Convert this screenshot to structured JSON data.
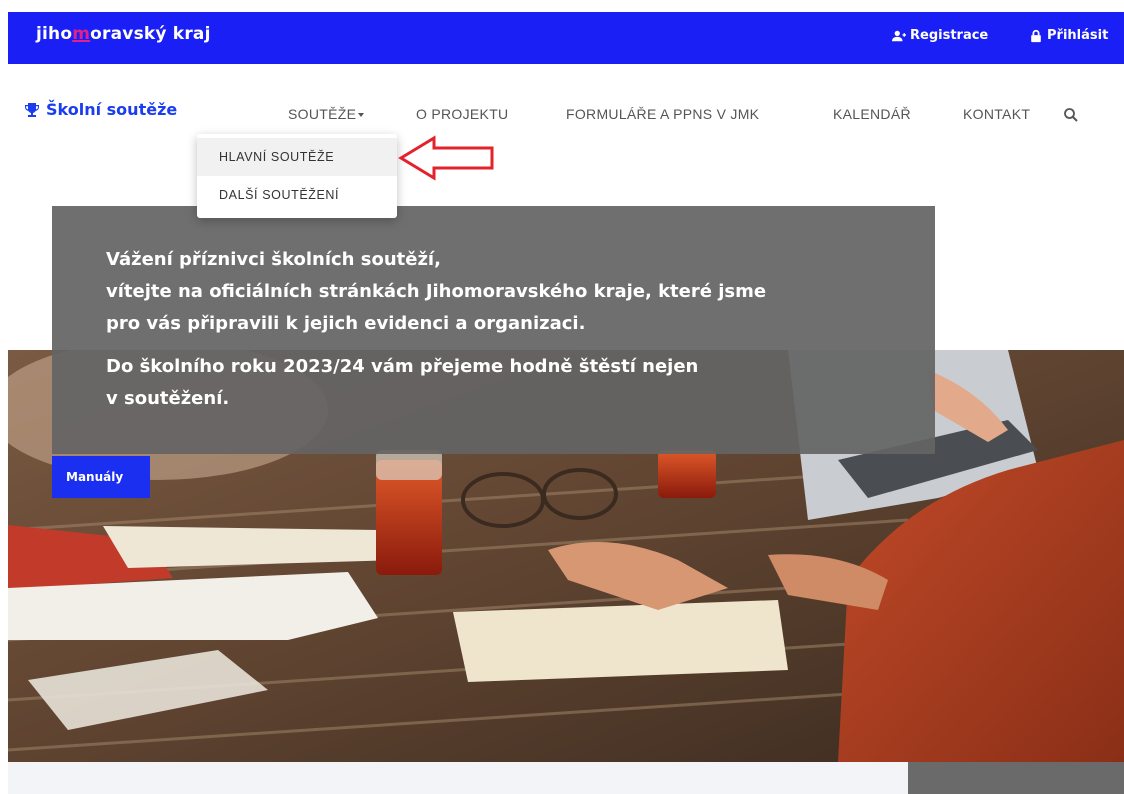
{
  "topbar": {
    "logo_before": "jiho",
    "logo_accent": "m",
    "logo_after": "oravský kraj",
    "register_label": "Registrace",
    "login_label": "Přihlásit",
    "bg_color": "#1a1ff5",
    "accent_color": "#e0218a"
  },
  "nav": {
    "site_title": "Školní soutěže",
    "site_icon": "trophy-icon",
    "items": [
      {
        "label": "SOUTĚŽE",
        "has_caret": true
      },
      {
        "label": "O PROJEKTU"
      },
      {
        "label": "FORMULÁŘE A PPNS V JMK"
      },
      {
        "label": "KALENDÁŘ"
      },
      {
        "label": "KONTAKT"
      }
    ],
    "search_icon": "search-icon"
  },
  "dropdown": {
    "items": [
      {
        "label": "HLAVNÍ SOUTĚŽE",
        "active": true
      },
      {
        "label": "DALŠÍ SOUTĚŽENÍ",
        "active": false
      }
    ]
  },
  "hero": {
    "line1": "Vážení příznivci školních soutěží,",
    "line2": "vítejte na oficiálních stránkách Jihomoravského kraje, které jsme",
    "line3": "pro vás připravili k jejich evidenci a organizaci.",
    "line4": "Do školního roku 2023/24 vám přejeme hodně štěstí nejen",
    "line5": "v soutěžení.",
    "button_label": "Manuály",
    "button_color": "#1a2ff0"
  },
  "annotation": {
    "arrow_color": "#e3232b"
  }
}
